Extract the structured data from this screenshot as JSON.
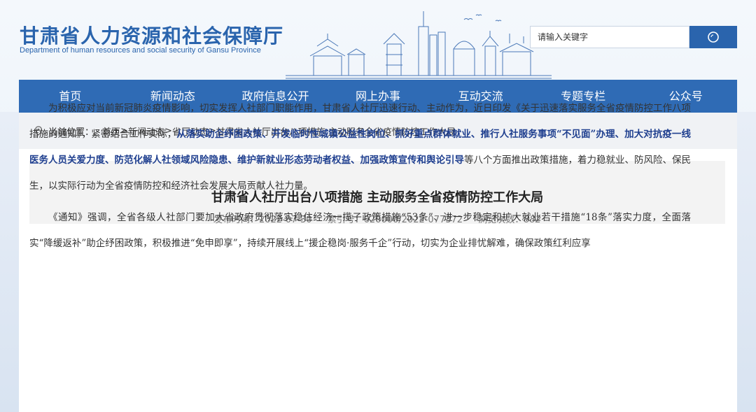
{
  "header": {
    "title": "甘肃省人力资源和社会保障厅",
    "subtitle": "Department of human resources and social security of Gansu Province",
    "search_placeholder": "请输入关键字"
  },
  "nav": {
    "items": [
      "首页",
      "新闻动态",
      "政府信息公开",
      "网上办事",
      "互动交流",
      "专题专栏",
      "公众号"
    ]
  },
  "breadcrumb": {
    "label": "当前位置：",
    "items": [
      "首页",
      "新闻动态",
      "省厅动态",
      "甘肃省人社厅出台八项措施 主动服务全省疫情防控工作大局"
    ],
    "separator": ">"
  },
  "article": {
    "title": "甘肃省人社厅出台八项措施 主动服务全省疫情防控工作大局",
    "publish_label": "发布时间：",
    "publish_date": "2022-07-30",
    "index_label": "索引号：",
    "index_no": "620000/2022-077372",
    "views_label": "浏览次数：",
    "views": "882",
    "p1_a": "为积极应对当前新冠肺炎疫情影响，切实发挥人社部门职能作用，甘肃省人社厅迅速行动、主动作为，近日印发《关于迅速落实服务全省疫情防控工作八项措施的通知》，紧密结合工作实际，",
    "p1_b": "从落实助企纾困政策、开发临时性城镇公益性岗位、抓好重点群体就业、推行人社服务事项“不见面”办理、加大对抗疫一线医务人员关爱力度、防范化解人社领域风险隐患、维护新就业形态劳动者权益、加强政策宣传和舆论引导",
    "p1_c": "等八个方面推出政策措施，着力稳就业、防风险、保民生，以实际行动为全省疫情防控和经济社会发展大局贡献人社力量。",
    "p2": "《通知》强调，全省各级人社部门要加大省政府贯彻落实稳住经济一揽子政策措施“53条”、进一步稳定和扩大就业若干措施“18条”落实力度，全面落实“降缓返补”助企纾困政策，积极推进“免申即享”，持续开展线上“援企稳岗·服务千企”行动，切实为企业排忧解难，确保政策红利应享"
  },
  "colors": {
    "brand": "#2a64ad",
    "nav_bg": "#2f6bb5",
    "highlight": "#1f3f8f"
  }
}
